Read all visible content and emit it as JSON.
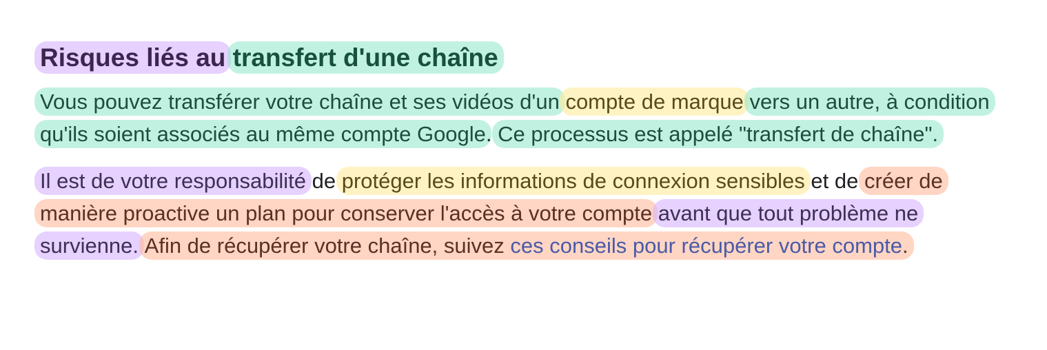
{
  "title": {
    "part1": "Risques liés au",
    "part2": "transfert d'une chaîne"
  },
  "paragraph1": {
    "s1": "Vous pouvez transférer votre chaîne et ses vidéos d'un",
    "s2": "compte de marque",
    "s3": "vers un autre, à condition qu'ils soient associés au même compte Google",
    "s4": ".",
    "s5": "Ce processus est appelé \"transfert de chaîne\"."
  },
  "paragraph2": {
    "s1": "Il est de votre responsabilité",
    "s2": "de",
    "s3": "protéger les informations de connexion sensibles",
    "s4": "et de",
    "s5": "créer de manière proactive un plan pour conserver l'accès à votre compte",
    "s6": "avant que tout problème ne survienne.",
    "s7": "Afin de récupérer votre chaîne, suivez",
    "link": "ces conseils pour récupérer votre compte",
    "s8": "."
  },
  "colors": {
    "purple_highlight": "#d7b4ff",
    "green_highlight": "#8ee8c8",
    "yellow_highlight": "#ffeca0",
    "orange_highlight": "#ffbc9e",
    "link": "#4a5aa8"
  }
}
